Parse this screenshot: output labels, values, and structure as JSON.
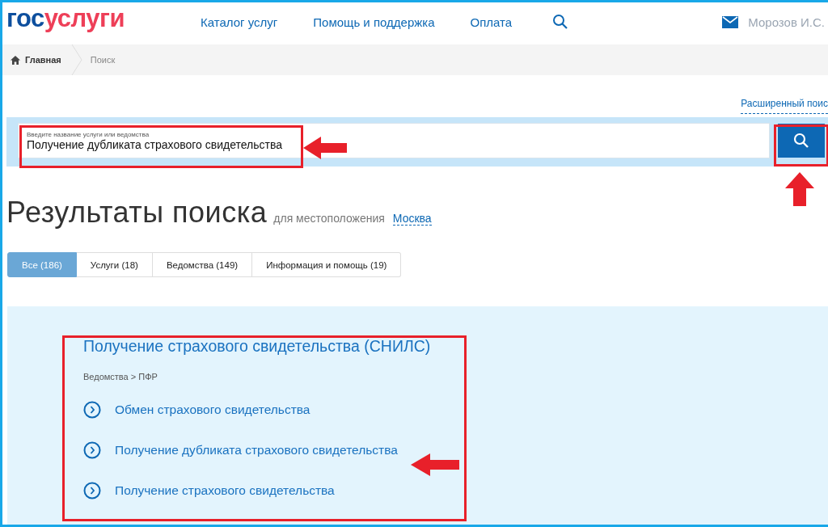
{
  "header": {
    "logo": [
      "гос",
      "услуги"
    ],
    "nav": [
      "Каталог услуг",
      "Помощь и поддержка",
      "Оплата"
    ],
    "user": "Морозов И.С."
  },
  "breadcrumbs": [
    "Главная",
    "Поиск"
  ],
  "advanced_search": "Расширенный поис",
  "search": {
    "label": "Введите название услуги или ведомства",
    "value": "Получение дубликата страхового свидетельства"
  },
  "results_heading": {
    "title": "Результаты поиска",
    "location_label": "для местоположения",
    "location": "Москва"
  },
  "tabs": [
    {
      "label": "Все (186)",
      "selected": true
    },
    {
      "label": "Услуги (18)",
      "selected": false
    },
    {
      "label": "Ведомства (149)",
      "selected": false
    },
    {
      "label": "Информация и помощь (19)",
      "selected": false
    }
  ],
  "result": {
    "title": "Получение страхового свидетельства (СНИЛС)",
    "path": "Ведомства > ПФР",
    "links": [
      "Обмен страхового свидетельства",
      "Получение дубликата страхового свидетельства",
      "Получение страхового свидетельства"
    ]
  }
}
